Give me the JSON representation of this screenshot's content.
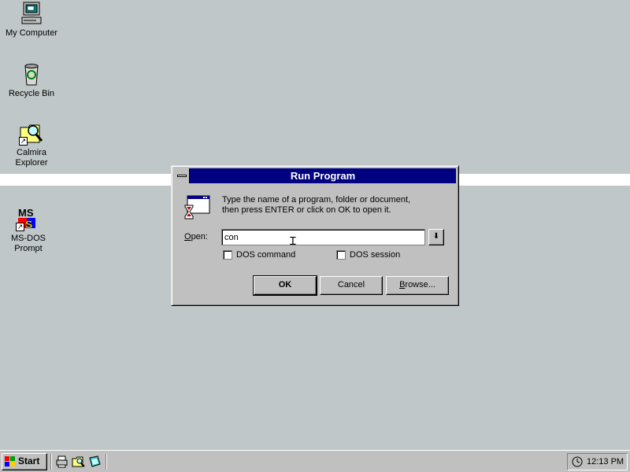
{
  "desktop": {
    "icons": [
      {
        "label": "My Computer",
        "icon": "computer-icon"
      },
      {
        "label": "Recycle Bin",
        "icon": "recycle-bin-icon"
      },
      {
        "label_line1": "Calmira",
        "label_line2": "Explorer",
        "icon": "folder-magnifier-icon"
      },
      {
        "label_line1": "MS-DOS",
        "label_line2": "Prompt",
        "icon": "ms-dos-icon"
      }
    ]
  },
  "dialog": {
    "title": "Run Program",
    "description_line1": "Type the name of a program, folder or document,",
    "description_line2": "then press ENTER or click on OK to open it.",
    "open_label_underlined": "O",
    "open_label_rest": "pen:",
    "open_value": "con",
    "checkboxes": [
      {
        "label": "DOS command",
        "checked": false
      },
      {
        "label": "DOS session",
        "checked": false
      }
    ],
    "buttons": {
      "ok": "OK",
      "cancel": "Cancel",
      "browse_underlined": "B",
      "browse_rest": "rowse..."
    }
  },
  "taskbar": {
    "start_label": "Start",
    "clock": "12:13 PM"
  },
  "colors": {
    "desktop": "#c0c7c8",
    "titlebar": "#000080",
    "face": "#c0c0c0"
  }
}
